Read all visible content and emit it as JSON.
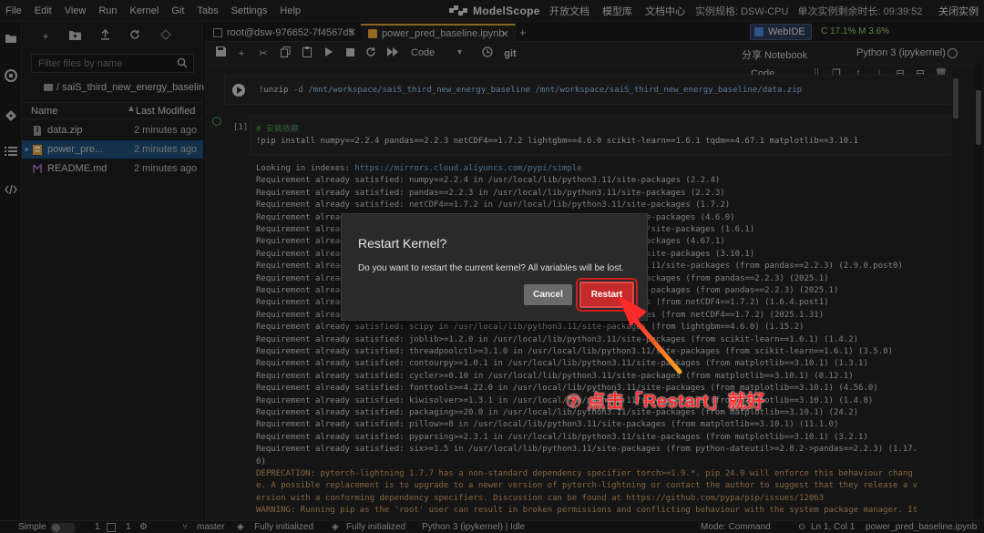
{
  "menubar": {
    "items": [
      "File",
      "Edit",
      "View",
      "Run",
      "Kernel",
      "Git",
      "Tabs",
      "Settings",
      "Help"
    ],
    "logo": "ModelScope",
    "links": [
      "开放文档",
      "模型库",
      "文档中心"
    ],
    "instance_spec": "实例规格: DSW-CPU",
    "instance_time": "单次实例剩余时长: 09:39:52",
    "close_instance": "关闭实例"
  },
  "filepanel": {
    "search_placeholder": "Filter files by name",
    "breadcrumb": "/ saiS_third_new_energy_baseline /",
    "col_name": "Name",
    "col_modified": "Last Modified",
    "files": [
      {
        "name": "data.zip",
        "modified": "2 minutes ago",
        "icon": "zip-icon",
        "selected": false
      },
      {
        "name": "power_pre...",
        "modified": "2 minutes ago",
        "icon": "notebook-icon",
        "selected": true
      },
      {
        "name": "README.md",
        "modified": "2 minutes ago",
        "icon": "markdown-icon",
        "selected": false
      }
    ]
  },
  "tabs": {
    "terminal": "root@dsw-976652-7f4567d5",
    "notebook": "power_pred_baseline.ipynb",
    "webide": "WebIDE",
    "meter": "C 17.1%  M 3.6%"
  },
  "toolbar": {
    "cell_type": "Code",
    "git": "git",
    "share": "分享 Notebook",
    "kernel": "Python 3 (ipykernel)"
  },
  "cellbar": {
    "cell_type": "Code"
  },
  "cells": {
    "cell1": {
      "cmd": "!unzip",
      "flag": "-d",
      "dest": "/mnt/workspace/saiS_third_new_energy_baseline",
      "src": "/mnt/workspace/saiS_third_new_energy_baseline/data.zip"
    },
    "cell2": {
      "prompt": "[1]:",
      "comment": "# 安装依赖",
      "line": "!pip install numpy==2.2.4 pandas==2.2.3 netCDF4==1.7.2 lightgbm==4.6.0 scikit-learn==1.6.1 tqdm==4.67.1 matplotlib==3.10.1"
    }
  },
  "output": {
    "index_prefix": "Looking in indexes: ",
    "index_url": "https://mirrors.cloud.aliyuncs.com/pypi/simple",
    "lines": [
      "Requirement already satisfied: numpy==2.2.4 in /usr/local/lib/python3.11/site-packages (2.2.4)",
      "Requirement already satisfied: pandas==2.2.3 in /usr/local/lib/python3.11/site-packages (2.2.3)",
      "Requirement already satisfied: netCDF4==1.7.2 in /usr/local/lib/python3.11/site-packages (1.7.2)",
      "Requirement already satisfied: lightgbm==4.6.0 in /usr/local/lib/python3.11/site-packages (4.6.0)",
      "Requirement already satisfied: scikit-learn==1.6.1 in /usr/local/lib/python3.11/site-packages (1.6.1)",
      "Requirement already satisfied: tqdm==4.67.1 in /usr/local/lib/python3.11/site-packages (4.67.1)",
      "Requirement already satisfied: matplotlib==3.10.1 in /usr/local/lib/python3.11/site-packages (3.10.1)",
      "Requirement already satisfied: python-dateutil>=2.8.2 in /usr/local/lib/python3.11/site-packages (from pandas==2.2.3) (2.9.0.post0)",
      "Requirement already satisfied: pytz>=2020.1 in /usr/local/lib/python3.11/site-packages (from pandas==2.2.3) (2025.1)",
      "Requirement already satisfied: tzdata>=2022.7 in /usr/local/lib/python3.11/site-packages (from pandas==2.2.3) (2025.1)",
      "Requirement already satisfied: cftime in /usr/local/lib/python3.11/site-packages (from netCDF4==1.7.2) (1.6.4.post1)",
      "Requirement already satisfied: certifi in /usr/local/lib/python3.11/site-packages (from netCDF4==1.7.2) (2025.1.31)",
      "Requirement already satisfied: scipy in /usr/local/lib/python3.11/site-packages (from lightgbm==4.6.0) (1.15.2)",
      "Requirement already satisfied: joblib>=1.2.0 in /usr/local/lib/python3.11/site-packages (from scikit-learn==1.6.1) (1.4.2)",
      "Requirement already satisfied: threadpoolctl>=3.1.0 in /usr/local/lib/python3.11/site-packages (from scikit-learn==1.6.1) (3.5.0)",
      "Requirement already satisfied: contourpy>=1.0.1 in /usr/local/lib/python3.11/site-packages (from matplotlib==3.10.1) (1.3.1)",
      "Requirement already satisfied: cycler>=0.10 in /usr/local/lib/python3.11/site-packages (from matplotlib==3.10.1) (0.12.1)",
      "Requirement already satisfied: fonttools>=4.22.0 in /usr/local/lib/python3.11/site-packages (from matplotlib==3.10.1) (4.56.0)",
      "Requirement already satisfied: kiwisolver>=1.3.1 in /usr/local/lib/python3.11/site-packages (from matplotlib==3.10.1) (1.4.8)",
      "Requirement already satisfied: packaging>=20.0 in /usr/local/lib/python3.11/site-packages (from matplotlib==3.10.1) (24.2)",
      "Requirement already satisfied: pillow>=8 in /usr/local/lib/python3.11/site-packages (from matplotlib==3.10.1) (11.1.0)",
      "Requirement already satisfied: pyparsing>=2.3.1 in /usr/local/lib/python3.11/site-packages (from matplotlib==3.10.1) (3.2.1)",
      "Requirement already satisfied: six>=1.5 in /usr/local/lib/python3.11/site-packages (from python-dateutil>=2.8.2->pandas==2.2.3) (1.17.",
      "0)"
    ],
    "warn_lines": [
      "DEPRECATION: pytorch-lightning 1.7.7 has a non-standard dependency specifier torch>=1.9.*. pip 24.0 will enforce this behaviour chang",
      "e. A possible replacement is to upgrade to a newer version of pytorch-lightning or contact the author to suggest that they release a v",
      "ersion with a conforming dependency specifiers. Discussion can be found at https://github.com/pypa/pip/issues/12063",
      "WARNING: Running pip as the 'root' user can result in broken permissions and conflicting behaviour with the system package manager. It"
    ]
  },
  "dialog": {
    "title": "Restart Kernel?",
    "body": "Do you want to restart the current kernel? All variables will be lost.",
    "cancel": "Cancel",
    "restart": "Restart"
  },
  "annotation": {
    "text": "⑦ 点击「Restart」就好",
    "color": "#ff2a2a"
  },
  "statusbar": {
    "mode_label": "Simple",
    "count1": "1",
    "count2": "1",
    "branch": "master",
    "init1": "Fully initialized",
    "init2": "Fully initialized",
    "kernel_status": "Python 3 (ipykernel) | Idle",
    "mode": "Mode: Command",
    "position": "Ln 1, Col 1",
    "file": "power_pred_baseline.ipynb"
  },
  "colors": {
    "accent": "#e2a63a",
    "restart_red": "#c62a2a",
    "selected_row": "#1f4f7a"
  }
}
